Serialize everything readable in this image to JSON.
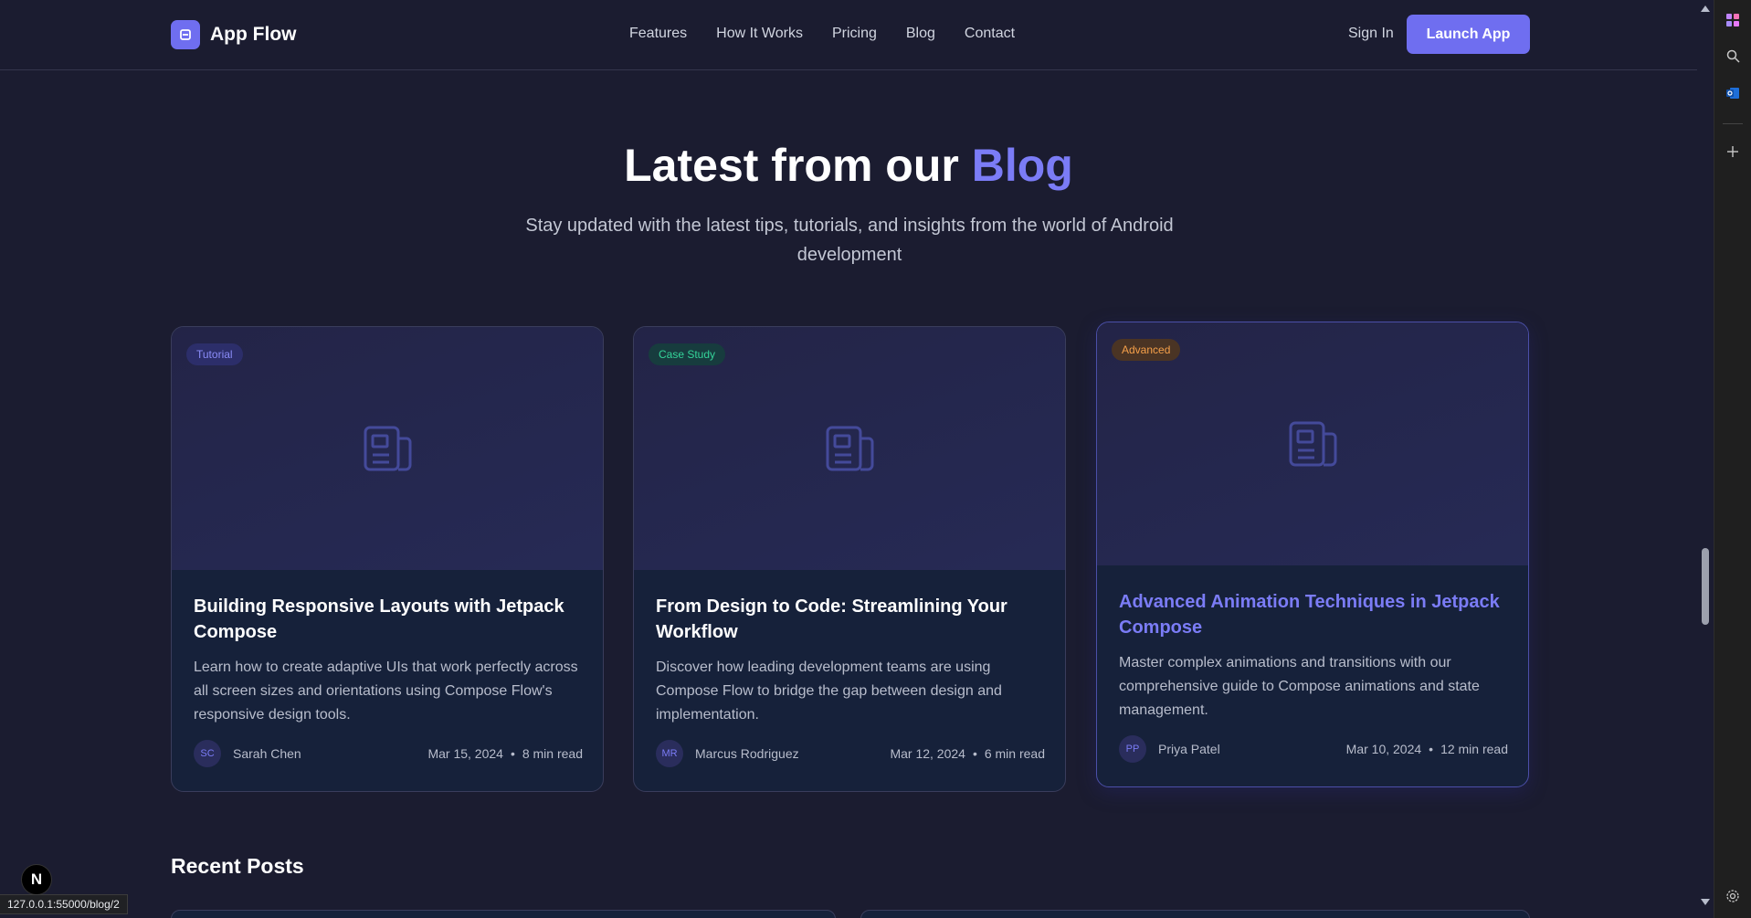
{
  "header": {
    "brand": "App Flow",
    "nav": [
      "Features",
      "How It Works",
      "Pricing",
      "Blog",
      "Contact"
    ],
    "sign_in": "Sign In",
    "launch": "Launch App"
  },
  "hero": {
    "title_prefix": "Latest from our",
    "title_accent": "Blog",
    "subtitle": "Stay updated with the latest tips, tutorials, and insights from the world of Android development"
  },
  "posts": [
    {
      "category": "Tutorial",
      "title": "Building Responsive Layouts with Jetpack Compose",
      "description": "Learn how to create adaptive UIs that work perfectly across all screen sizes and orientations using Compose Flow's responsive design tools.",
      "initials": "SC",
      "author": "Sarah Chen",
      "date": "Mar 15, 2024",
      "read_time": "8 min read"
    },
    {
      "category": "Case Study",
      "title": "From Design to Code: Streamlining Your Workflow",
      "description": "Discover how leading development teams are using Compose Flow to bridge the gap between design and implementation.",
      "initials": "MR",
      "author": "Marcus Rodriguez",
      "date": "Mar 12, 2024",
      "read_time": "6 min read"
    },
    {
      "category": "Advanced",
      "title": "Advanced Animation Techniques in Jetpack Compose",
      "description": "Master complex animations and transitions with our comprehensive guide to Compose animations and state management.",
      "initials": "PP",
      "author": "Priya Patel",
      "date": "Mar 10, 2024",
      "read_time": "12 min read"
    }
  ],
  "recent": {
    "title": "Recent Posts"
  },
  "status_bar": {
    "url": "127.0.0.1:55000/blog/2"
  },
  "dev": {
    "next_badge": "N"
  },
  "colors": {
    "accent": "#6f6ef0",
    "background": "#1b1c30",
    "card": "#16213a",
    "tutorial_badge": "#8a8cf8",
    "case_study_badge": "#34d399",
    "advanced_badge": "#f5a04a"
  }
}
